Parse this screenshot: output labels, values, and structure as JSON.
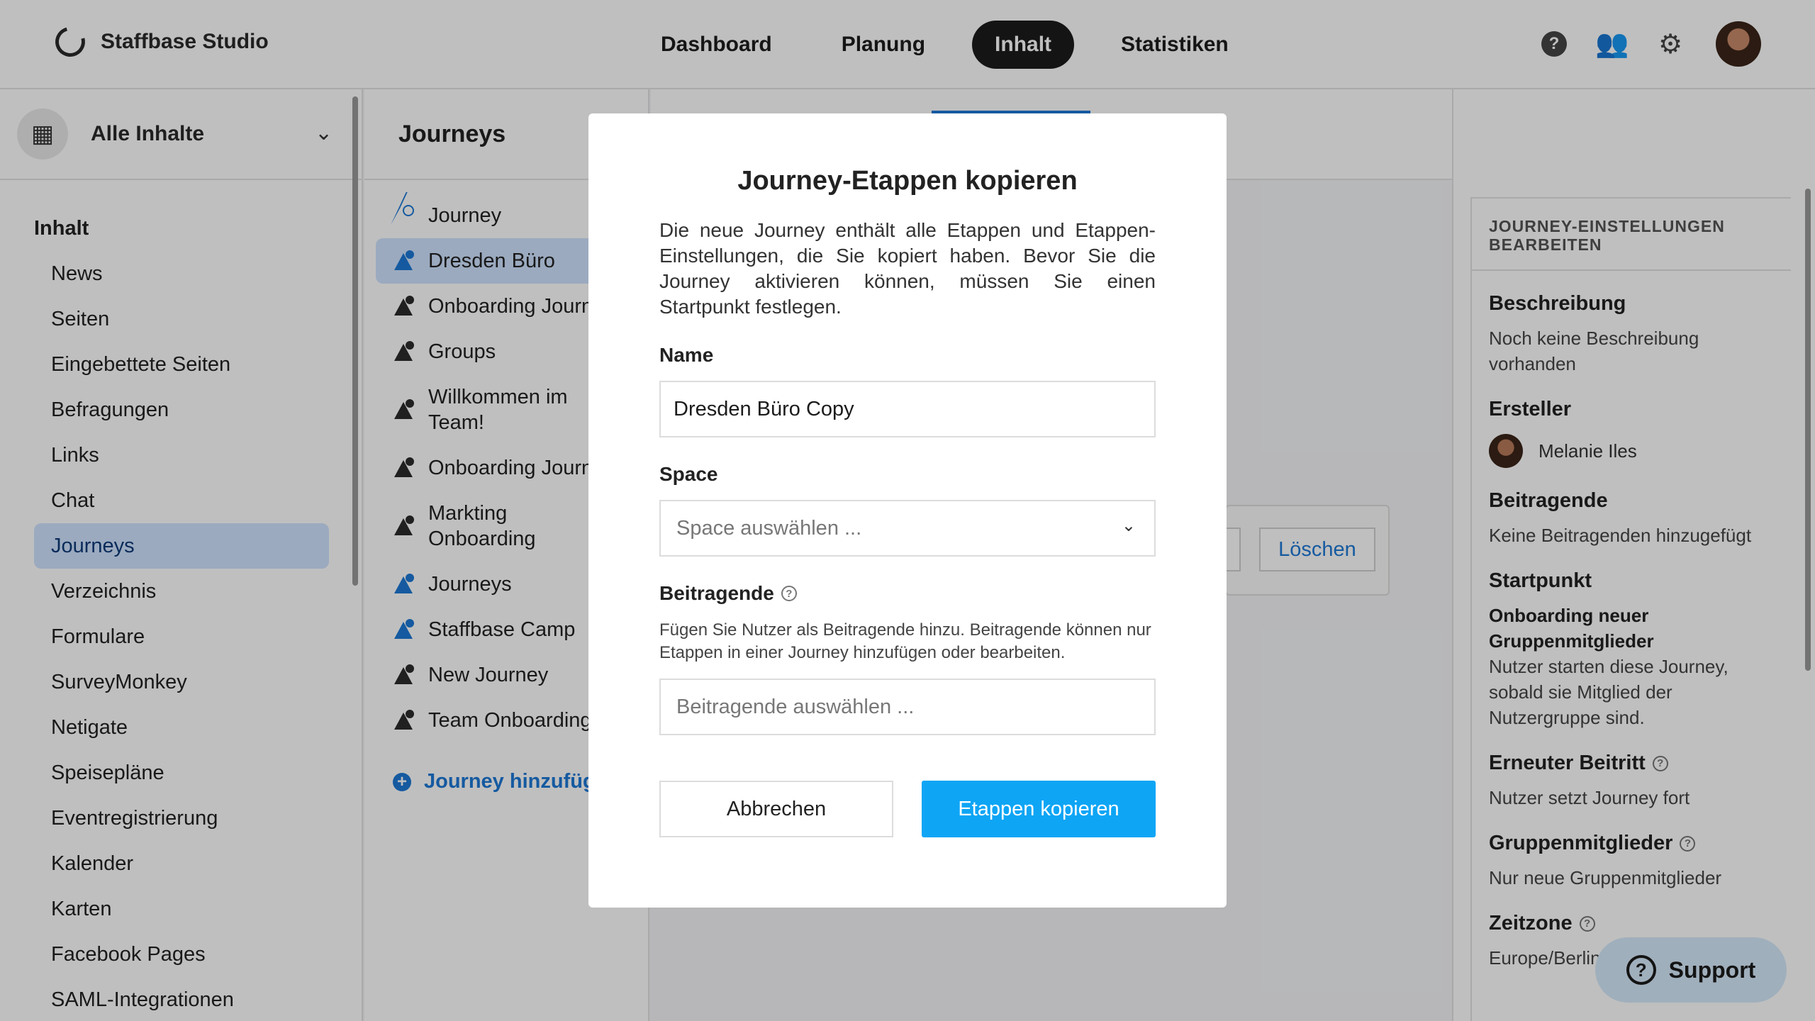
{
  "header": {
    "brand": "Staffbase Studio",
    "nav": [
      {
        "label": "Dashboard",
        "active": false
      },
      {
        "label": "Planung",
        "active": false
      },
      {
        "label": "Inhalt",
        "active": true
      },
      {
        "label": "Statistiken",
        "active": false
      }
    ],
    "icons": [
      "help-icon",
      "people-icon",
      "gear-icon",
      "user-avatar"
    ]
  },
  "sidebar": {
    "filter_label": "Alle Inhalte",
    "section_title": "Inhalt",
    "items": [
      {
        "label": "News"
      },
      {
        "label": "Seiten"
      },
      {
        "label": "Eingebettete Seiten"
      },
      {
        "label": "Befragungen"
      },
      {
        "label": "Links"
      },
      {
        "label": "Chat"
      },
      {
        "label": "Journeys",
        "active": true
      },
      {
        "label": "Verzeichnis"
      },
      {
        "label": "Formulare"
      },
      {
        "label": "SurveyMonkey"
      },
      {
        "label": "Netigate"
      },
      {
        "label": "Speisepläne"
      },
      {
        "label": "Eventregistrierung"
      },
      {
        "label": "Kalender"
      },
      {
        "label": "Karten"
      },
      {
        "label": "Facebook Pages"
      },
      {
        "label": "SAML-Integrationen"
      }
    ]
  },
  "journeys": {
    "title": "Journeys",
    "items": [
      {
        "label": "Journey",
        "icon": "journey-outline-icon"
      },
      {
        "label": "Dresden Büro",
        "icon": "journey-blue-icon",
        "active": true
      },
      {
        "label": "Onboarding Journ",
        "icon": "journey-icon"
      },
      {
        "label": "Groups",
        "icon": "journey-icon"
      },
      {
        "label": "Willkommen im Team!",
        "icon": "journey-icon",
        "two_line": true
      },
      {
        "label": "Onboarding Journ",
        "icon": "journey-icon"
      },
      {
        "label": "Markting Onboarding",
        "icon": "journey-icon",
        "two_line": true
      },
      {
        "label": "Journeys",
        "icon": "journey-blue-icon"
      },
      {
        "label": "Staffbase Camp",
        "icon": "journey-blue-icon"
      },
      {
        "label": "New Journey",
        "icon": "journey-icon"
      },
      {
        "label": "Team Onboarding",
        "icon": "journey-icon"
      }
    ],
    "add_label": "Journey hinzufüge"
  },
  "content": {
    "delete_label": "Löschen"
  },
  "settings": {
    "heading": "JOURNEY-EINSTELLUNGEN BEARBEITEN",
    "description_label": "Beschreibung",
    "description_value": "Noch keine Beschreibung vorhanden",
    "creator_label": "Ersteller",
    "creator_name": "Melanie Iles",
    "contributors_label": "Beitragende",
    "contributors_value": "Keine Beitragenden hinzugefügt",
    "start_label": "Startpunkt",
    "start_title": "Onboarding neuer Gruppenmitglieder",
    "start_text": "Nutzer starten diese Journey, sobald sie Mitglied der Nutzergruppe sind.",
    "rejoin_label": "Erneuter Beitritt",
    "rejoin_value": "Nutzer setzt Journey fort",
    "group_label": "Gruppenmitglieder",
    "group_value": "Nur neue Gruppenmitglieder",
    "tz_label": "Zeitzone",
    "tz_value": "Europe/Berlin"
  },
  "support_label": "Support",
  "modal": {
    "title": "Journey-Etappen kopieren",
    "description": "Die neue Journey enthält alle Etappen und Etappen-Einstellungen, die Sie kopiert haben. Bevor Sie die Journey aktivieren können, müssen Sie einen Startpunkt festlegen.",
    "name_label": "Name",
    "name_value": "Dresden Büro Copy",
    "space_label": "Space",
    "space_placeholder": "Space auswählen ...",
    "contrib_label": "Beitragende",
    "contrib_hint": "Fügen Sie Nutzer als Beitragende hinzu. Beitragende können nur Etappen in einer Journey hinzufügen oder bearbeiten.",
    "contrib_placeholder": "Beitragende auswählen ...",
    "cancel_label": "Abbrechen",
    "confirm_label": "Etappen kopieren"
  }
}
